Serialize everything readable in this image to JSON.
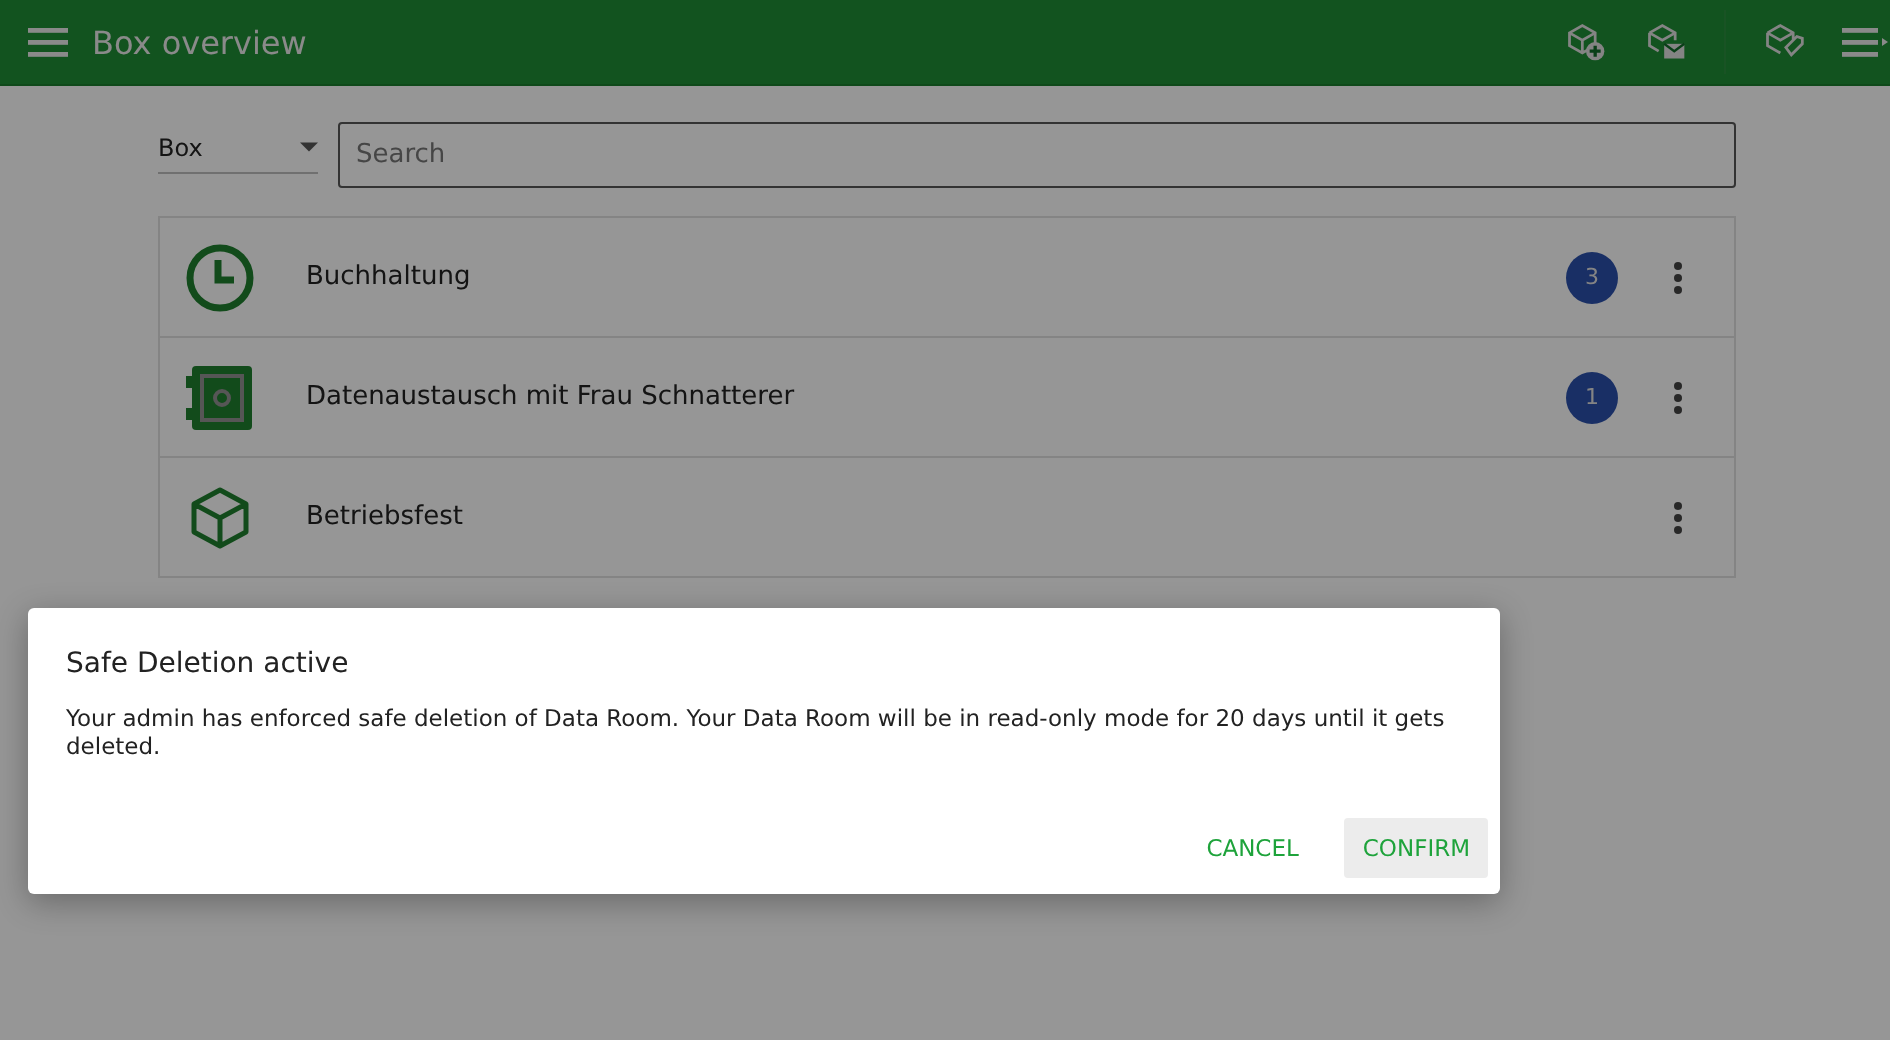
{
  "app_bar": {
    "title": "Box overview"
  },
  "filter": {
    "select": "Box",
    "search_placeholder": "Search"
  },
  "boxes": [
    {
      "kind": "clock",
      "name": "Buchhaltung",
      "count": "3"
    },
    {
      "kind": "safe",
      "name": "Datenaustausch mit Frau Schnatterer",
      "count": "1"
    },
    {
      "kind": "cube",
      "name": "Betriebsfest"
    }
  ],
  "dialog": {
    "title": "Safe Deletion active",
    "message": "Your admin has enforced safe deletion of Data Room. Your Data Room will be in read-only mode for 20 days until it gets deleted.",
    "buttons": [
      {
        "label": "CANCEL",
        "focused": false
      },
      {
        "label": "CONFIRM",
        "focused": true
      }
    ]
  }
}
